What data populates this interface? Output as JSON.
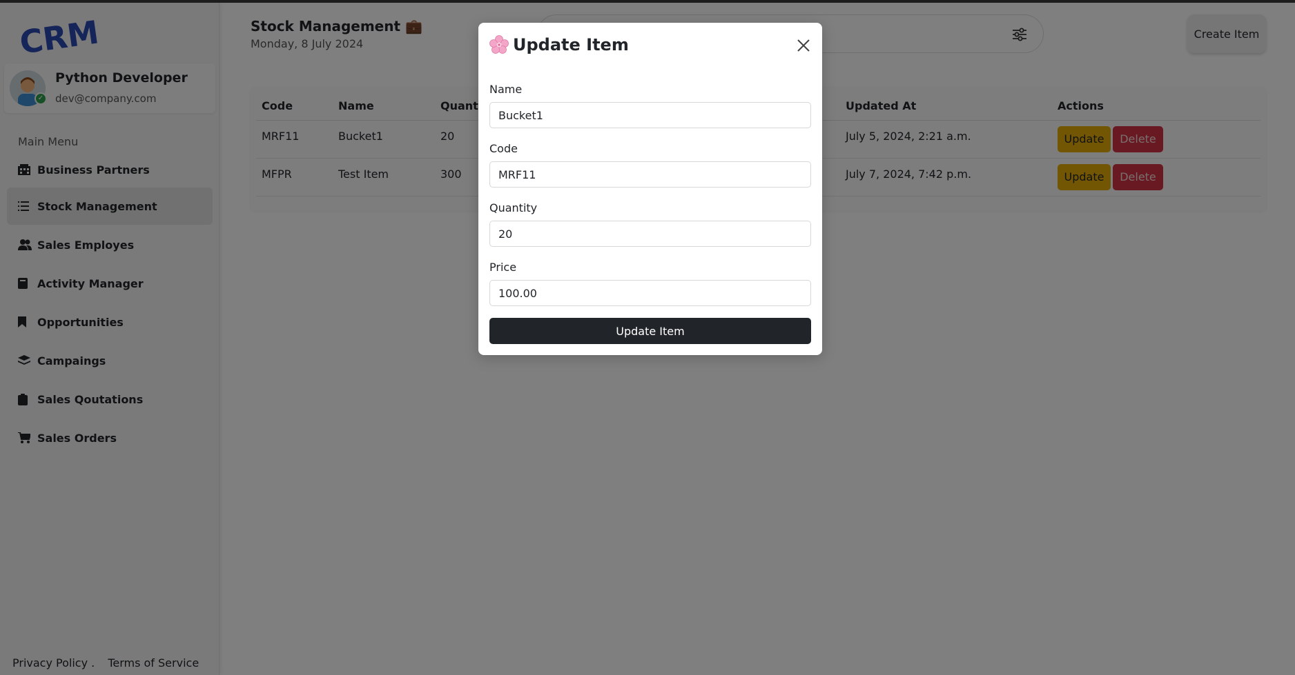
{
  "app": {
    "logo_text": "CRM"
  },
  "profile": {
    "name": "Python Developer",
    "email": "dev@company.com"
  },
  "menu": {
    "title": "Main Menu",
    "items": [
      {
        "label": "Business Partners",
        "icon": "building-icon"
      },
      {
        "label": "Stock Management",
        "icon": "list-icon",
        "active": true
      },
      {
        "label": "Sales Employes",
        "icon": "users-icon"
      },
      {
        "label": "Activity Manager",
        "icon": "book-icon"
      },
      {
        "label": "Opportunities",
        "icon": "bookmark-icon"
      },
      {
        "label": "Campaings",
        "icon": "layers-icon"
      },
      {
        "label": "Sales Qoutations",
        "icon": "clipboard-icon"
      },
      {
        "label": "Sales Orders",
        "icon": "cart-icon"
      }
    ]
  },
  "footer": {
    "privacy": "Privacy Policy .",
    "terms": "Terms of Service"
  },
  "header": {
    "title": "Stock Management 💼",
    "date": "Monday, 8 July 2024",
    "create_label": "Create Item"
  },
  "table": {
    "columns": [
      "Code",
      "Name",
      "Quantit",
      "Updated At",
      "Actions"
    ],
    "rows": [
      {
        "code": "MRF11",
        "name": "Bucket1",
        "quantity": "20",
        "updated": "July 5, 2024, 2:21 a.m."
      },
      {
        "code": "MFPR",
        "name": "Test Item",
        "quantity": "300",
        "updated": "July 7, 2024, 7:42 p.m."
      }
    ],
    "update_label": "Update",
    "delete_label": "Delete"
  },
  "modal": {
    "title": "Update Item",
    "fields": {
      "name": {
        "label": "Name",
        "value": "Bucket1"
      },
      "code": {
        "label": "Code",
        "value": "MRF11"
      },
      "quantity": {
        "label": "Quantity",
        "value": "20"
      },
      "price": {
        "label": "Price",
        "value": "100.00"
      }
    },
    "submit_label": "Update Item"
  },
  "colors": {
    "update": "#e6ad07",
    "delete": "#d33343",
    "submit": "#212529",
    "logo": "#2c4bb3"
  }
}
